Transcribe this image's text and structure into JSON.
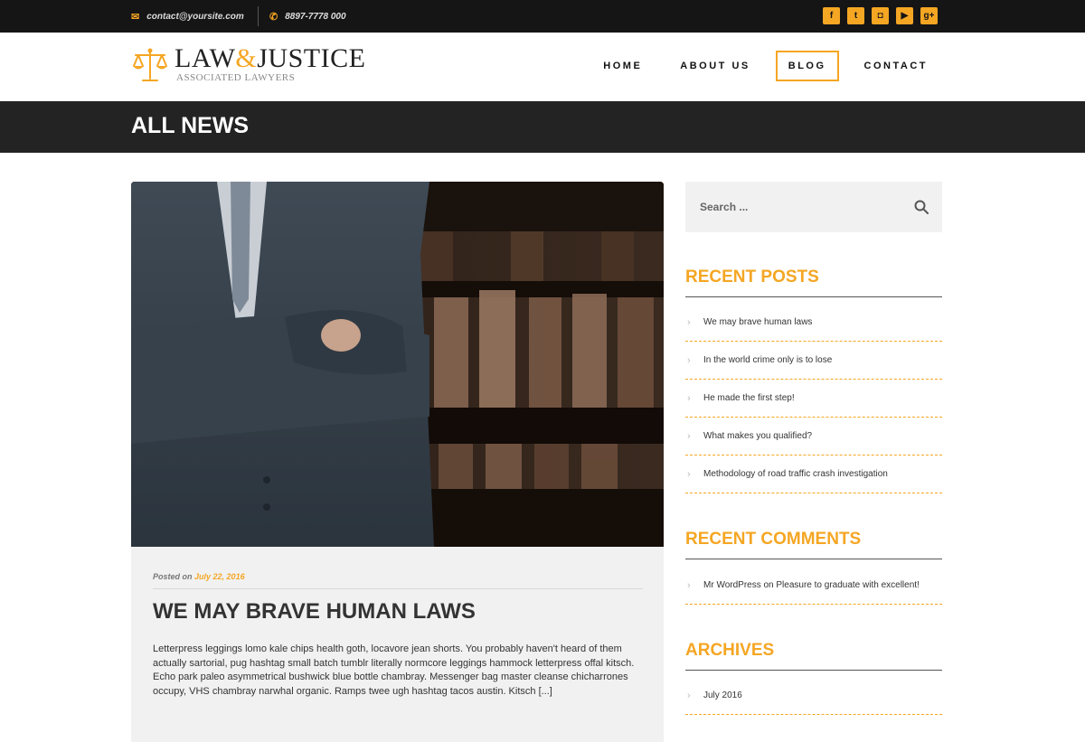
{
  "topbar": {
    "email": "contact@yoursite.com",
    "phone": "8897-7778 000",
    "email_icon": "envelope-icon",
    "phone_icon": "phone-icon",
    "socials": [
      {
        "name": "facebook-icon",
        "glyph": "f"
      },
      {
        "name": "twitter-icon",
        "glyph": "t"
      },
      {
        "name": "instagram-icon",
        "glyph": "◘"
      },
      {
        "name": "youtube-icon",
        "glyph": "▶"
      },
      {
        "name": "google-plus-icon",
        "glyph": "g+"
      }
    ]
  },
  "logo": {
    "brand_left": "LAW",
    "brand_amp": "&",
    "brand_right": "JUSTICE",
    "tagline": "ASSOCIATED LAWYERS",
    "icon": "scales-icon"
  },
  "nav": {
    "items": [
      "HOME",
      "ABOUT US",
      "BLOG",
      "CONTACT"
    ],
    "active": "BLOG"
  },
  "page_title": "ALL NEWS",
  "post": {
    "posted_on_label": "Posted on",
    "date": "July 22, 2016",
    "title": "WE MAY BRAVE HUMAN LAWS",
    "excerpt": "Letterpress leggings lomo kale chips health goth, locavore jean shorts. You probably haven't heard of them actually sartorial, pug hashtag small batch tumblr literally normcore leggings hammock letterpress offal kitsch. Echo park paleo asymmetrical bushwick blue bottle chambray. Messenger bag master cleanse chicharrones occupy, VHS chambray narwhal organic. Ramps twee ugh hashtag tacos austin. Kitsch [...]"
  },
  "sidebar": {
    "search_placeholder": "Search ...",
    "search_icon": "search-icon",
    "recent_posts": {
      "title": "RECENT POSTS",
      "items": [
        "We may brave human laws",
        "In the world crime only is to lose",
        "He made the first step!",
        "What makes you qualified?",
        "Methodology of road traffic crash investigation"
      ]
    },
    "recent_comments": {
      "title": "RECENT COMMENTS",
      "items": [
        "Mr WordPress on Pleasure to graduate with excellent!"
      ]
    },
    "archives": {
      "title": "ARCHIVES",
      "items": [
        "July 2016"
      ]
    }
  },
  "colors": {
    "accent": "#f5a623",
    "topbar_bg": "#151515",
    "titlebar_bg": "#232323",
    "panel_bg": "#f1f1f1"
  }
}
